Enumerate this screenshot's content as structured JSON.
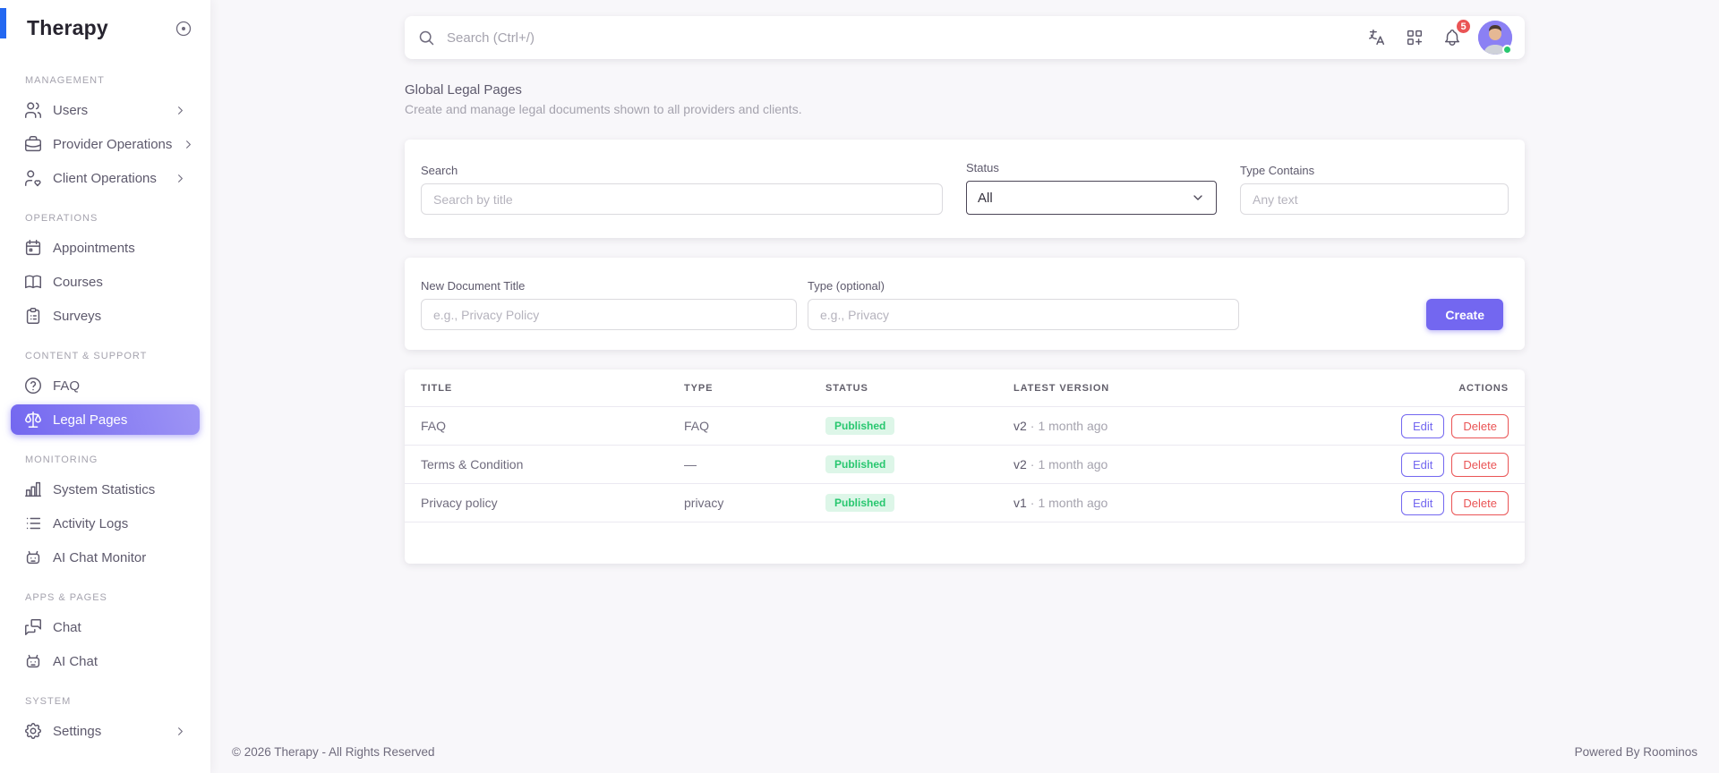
{
  "brand": {
    "name": "Therapy"
  },
  "sidebar": {
    "sections": [
      {
        "label": "Management",
        "items": [
          {
            "label": "Users",
            "icon": "users-icon",
            "has_submenu": true,
            "active": false
          },
          {
            "label": "Provider Operations",
            "icon": "briefcase-icon",
            "has_submenu": true,
            "active": false
          },
          {
            "label": "Client Operations",
            "icon": "user-heart-icon",
            "has_submenu": true,
            "active": false
          }
        ]
      },
      {
        "label": "Operations",
        "items": [
          {
            "label": "Appointments",
            "icon": "calendar-icon",
            "has_submenu": false,
            "active": false
          },
          {
            "label": "Courses",
            "icon": "book-icon",
            "has_submenu": false,
            "active": false
          },
          {
            "label": "Surveys",
            "icon": "clipboard-icon",
            "has_submenu": false,
            "active": false
          }
        ]
      },
      {
        "label": "Content & Support",
        "items": [
          {
            "label": "FAQ",
            "icon": "help-circle-icon",
            "has_submenu": false,
            "active": false
          },
          {
            "label": "Legal Pages",
            "icon": "scale-icon",
            "has_submenu": false,
            "active": true
          }
        ]
      },
      {
        "label": "Monitoring",
        "items": [
          {
            "label": "System Statistics",
            "icon": "bar-chart-icon",
            "has_submenu": false,
            "active": false
          },
          {
            "label": "Activity Logs",
            "icon": "list-icon",
            "has_submenu": false,
            "active": false
          },
          {
            "label": "AI Chat Monitor",
            "icon": "robot-icon",
            "has_submenu": false,
            "active": false
          }
        ]
      },
      {
        "label": "Apps & Pages",
        "items": [
          {
            "label": "Chat",
            "icon": "chat-icon",
            "has_submenu": false,
            "active": false
          },
          {
            "label": "AI Chat",
            "icon": "robot-icon",
            "has_submenu": false,
            "active": false
          }
        ]
      },
      {
        "label": "System",
        "items": [
          {
            "label": "Settings",
            "icon": "gear-icon",
            "has_submenu": true,
            "active": false
          }
        ]
      }
    ]
  },
  "topbar": {
    "search_placeholder": "Search (Ctrl+/)",
    "notification_count": "5"
  },
  "page": {
    "title": "Global Legal Pages",
    "subtitle": "Create and manage legal documents shown to all providers and clients."
  },
  "filters": {
    "search_label": "Search",
    "search_placeholder": "Search by title",
    "status_label": "Status",
    "status_value": "All",
    "type_label": "Type Contains",
    "type_placeholder": "Any text"
  },
  "create_form": {
    "title_label": "New Document Title",
    "title_placeholder": "e.g., Privacy Policy",
    "type_label": "Type (optional)",
    "type_placeholder": "e.g., Privacy",
    "button_label": "Create"
  },
  "table": {
    "columns": {
      "title": "Title",
      "type": "Type",
      "status": "Status",
      "latest_version": "Latest Version",
      "actions": "Actions"
    },
    "edit_label": "Edit",
    "delete_label": "Delete",
    "version_separator": "·",
    "rows": [
      {
        "title": "FAQ",
        "type": "FAQ",
        "status": "Published",
        "version": "v2",
        "updated": "1 month ago"
      },
      {
        "title": "Terms & Condition",
        "type": "—",
        "status": "Published",
        "version": "v2",
        "updated": "1 month ago"
      },
      {
        "title": "Privacy policy",
        "type": "privacy",
        "status": "Published",
        "version": "v1",
        "updated": "1 month ago"
      }
    ]
  },
  "footer": {
    "copyright": "© 2026 Therapy - All Rights Reserved",
    "powered_by": "Powered By Roominos"
  },
  "colors": {
    "primary": "#7367f0",
    "success": "#28c76f",
    "success_bg": "#ddf6e8",
    "danger": "#ea5455",
    "brand_accent_bar": "#2368f1",
    "background": "#f8f7fa"
  }
}
